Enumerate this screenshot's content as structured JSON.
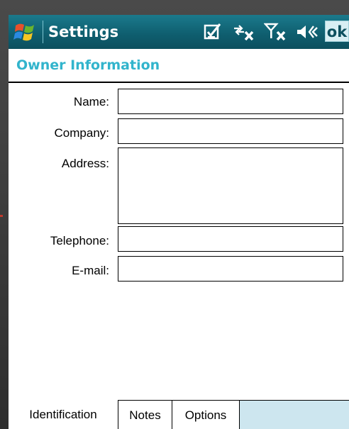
{
  "window": {
    "title": "Settings",
    "ok_label": "ok",
    "status_icons": [
      "tasks-icon",
      "connectivity-off-icon",
      "signal-off-icon",
      "volume-icon"
    ]
  },
  "section": {
    "title": "Owner Information"
  },
  "form": {
    "name": {
      "label": "Name:",
      "value": ""
    },
    "company": {
      "label": "Company:",
      "value": ""
    },
    "address": {
      "label": "Address:",
      "value": ""
    },
    "telephone": {
      "label": "Telephone:",
      "value": ""
    },
    "email": {
      "label": "E-mail:",
      "value": ""
    }
  },
  "tabs": [
    {
      "label": "Identification",
      "active": true
    },
    {
      "label": "Notes",
      "active": false
    },
    {
      "label": "Options",
      "active": false
    }
  ],
  "colors": {
    "titlebar": "#0f5f70",
    "accent_text": "#32b4cc",
    "tabbar_bg": "#cde6ef"
  }
}
